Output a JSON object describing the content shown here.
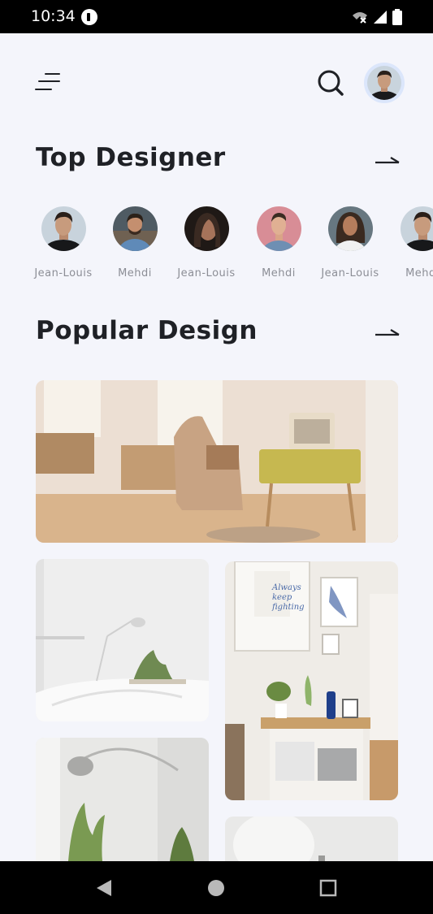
{
  "status_bar": {
    "time": "10:34",
    "icons": [
      "app-notification-icon",
      "wifi-off-icon",
      "cell-signal-icon",
      "battery-icon"
    ]
  },
  "header": {
    "menu_icon": "menu-icon",
    "search_icon": "search-icon",
    "profile_avatar": "profile-avatar"
  },
  "top_designer": {
    "title": "Top Designer",
    "arrow_icon": "arrow-right-icon",
    "designers": [
      {
        "name": "Jean-Louis",
        "avatar_bg": "#c8d3dc"
      },
      {
        "name": "Mehdi",
        "avatar_bg": "#5c6d7a"
      },
      {
        "name": "Jean-Louis",
        "avatar_bg": "#2a211d"
      },
      {
        "name": "Mehdi",
        "avatar_bg": "#d98a92"
      },
      {
        "name": "Jean-Louis",
        "avatar_bg": "#6a7a82"
      },
      {
        "name": "Mehdi",
        "avatar_bg": "#c8d3dc"
      }
    ]
  },
  "popular_design": {
    "title": "Popular Design",
    "arrow_icon": "arrow-right-icon",
    "cards": [
      {
        "name": "living-room-armchair",
        "bg": "#e9ded2"
      },
      {
        "name": "white-bedroom",
        "bg": "#ececec"
      },
      {
        "name": "gallery-wall-shelf",
        "bg": "#eeeae4"
      },
      {
        "name": "arc-lamp-room",
        "bg": "#e4e4e2"
      },
      {
        "name": "white-wall-room",
        "bg": "#e6e6e6"
      }
    ],
    "poster_text": "Always keep fighting"
  },
  "nav_bar": {
    "back_icon": "back-icon",
    "home_icon": "home-icon",
    "recents_icon": "recents-icon"
  }
}
